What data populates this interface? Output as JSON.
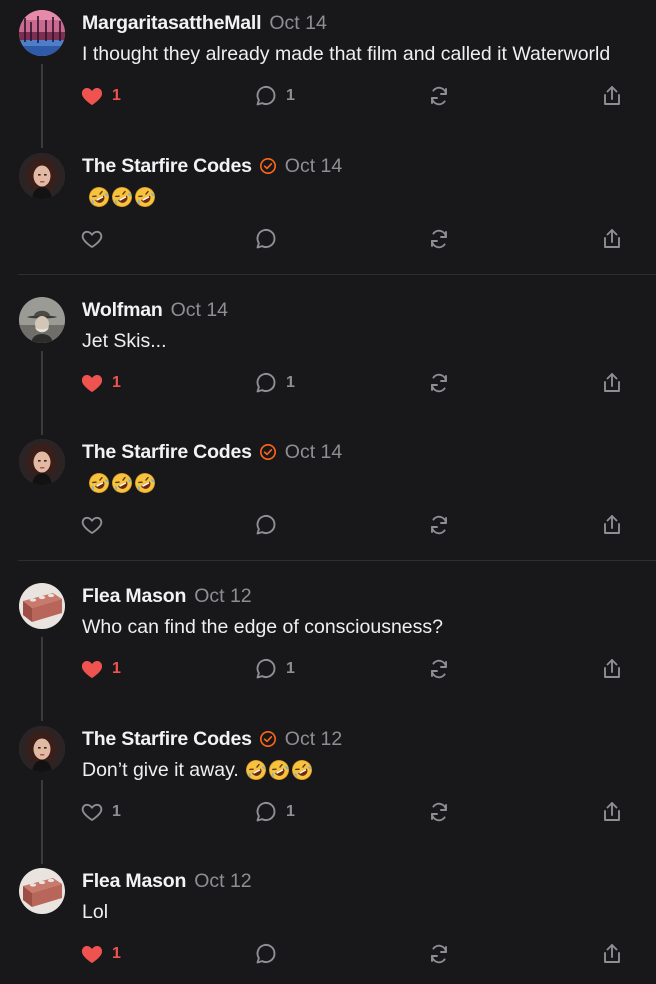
{
  "colors": {
    "background": "#18181a",
    "heart_active": "#ef5350",
    "icon_muted": "#8e8e93",
    "verified_badge": "#ff6719"
  },
  "posts": [
    {
      "author": "MargaritasattheMall",
      "date": "Oct 14",
      "text": "I thought they already made that film and called it Waterworld",
      "emoji": "",
      "verified": false,
      "liked": true,
      "likes": "1",
      "comments": "1",
      "avatar": "sunset-lake-avatar"
    },
    {
      "author": "The Starfire Codes",
      "date": "Oct 14",
      "text": "",
      "emoji": "🤣🤣🤣",
      "verified": true,
      "liked": false,
      "likes": "",
      "comments": "",
      "avatar": "woman-portrait-avatar"
    },
    {
      "author": "Wolfman",
      "date": "Oct 14",
      "text": "Jet Skis...",
      "emoji": "",
      "verified": false,
      "liked": true,
      "likes": "1",
      "comments": "1",
      "avatar": "hat-man-avatar"
    },
    {
      "author": "The Starfire Codes",
      "date": "Oct 14",
      "text": "",
      "emoji": "🤣🤣🤣",
      "verified": true,
      "liked": false,
      "likes": "",
      "comments": "",
      "avatar": "woman-portrait-avatar"
    },
    {
      "author": "Flea Mason",
      "date": "Oct 12",
      "text": "Who can find the edge of consciousness?",
      "emoji": "",
      "verified": false,
      "liked": true,
      "likes": "1",
      "comments": "1",
      "avatar": "brick-avatar"
    },
    {
      "author": "The Starfire Codes",
      "date": "Oct 12",
      "text": "Don’t give it away.",
      "emoji": "🤣🤣🤣",
      "verified": true,
      "liked": false,
      "likes": "1",
      "comments": "1",
      "avatar": "woman-portrait-avatar"
    },
    {
      "author": "Flea Mason",
      "date": "Oct 12",
      "text": "Lol",
      "emoji": "",
      "verified": false,
      "liked": true,
      "likes": "1",
      "comments": "",
      "avatar": "brick-avatar"
    }
  ]
}
